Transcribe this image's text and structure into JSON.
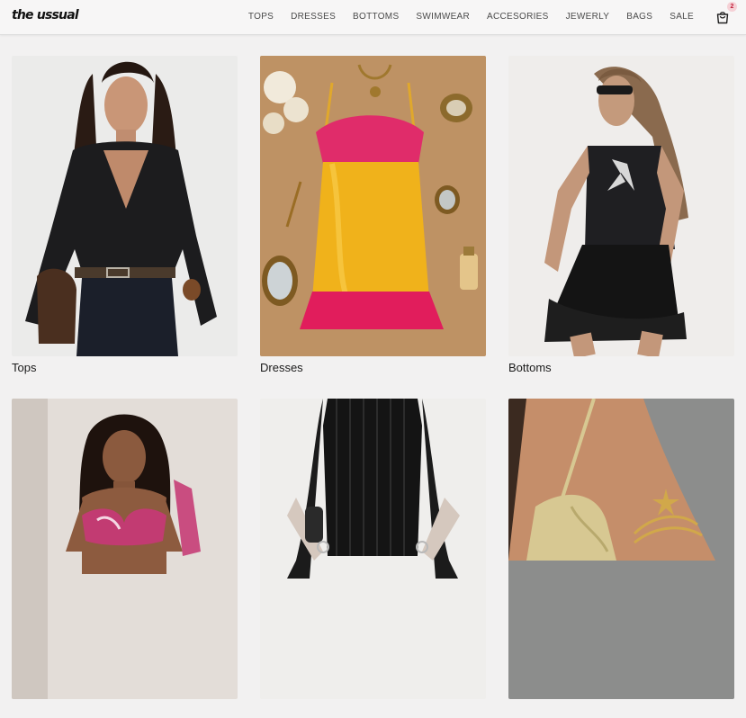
{
  "brand": {
    "logo_text": "the ussual"
  },
  "nav": {
    "items": [
      "TOPS",
      "DRESSES",
      "BOTTOMS",
      "SWIMWEAR",
      "ACCESORIES",
      "JEWERLY",
      "BAGS",
      "SALE"
    ]
  },
  "cart": {
    "icon": "shopping-bag-icon",
    "count": "2"
  },
  "categories": [
    {
      "label": "Tops"
    },
    {
      "label": "Dresses"
    },
    {
      "label": "Bottoms"
    },
    {
      "label": ""
    },
    {
      "label": ""
    },
    {
      "label": ""
    }
  ],
  "colors": {
    "background": "#f2f1f1",
    "header": "#f7f6f6",
    "badge_bg": "#f5d1d6",
    "badge_text": "#c21f3a"
  }
}
